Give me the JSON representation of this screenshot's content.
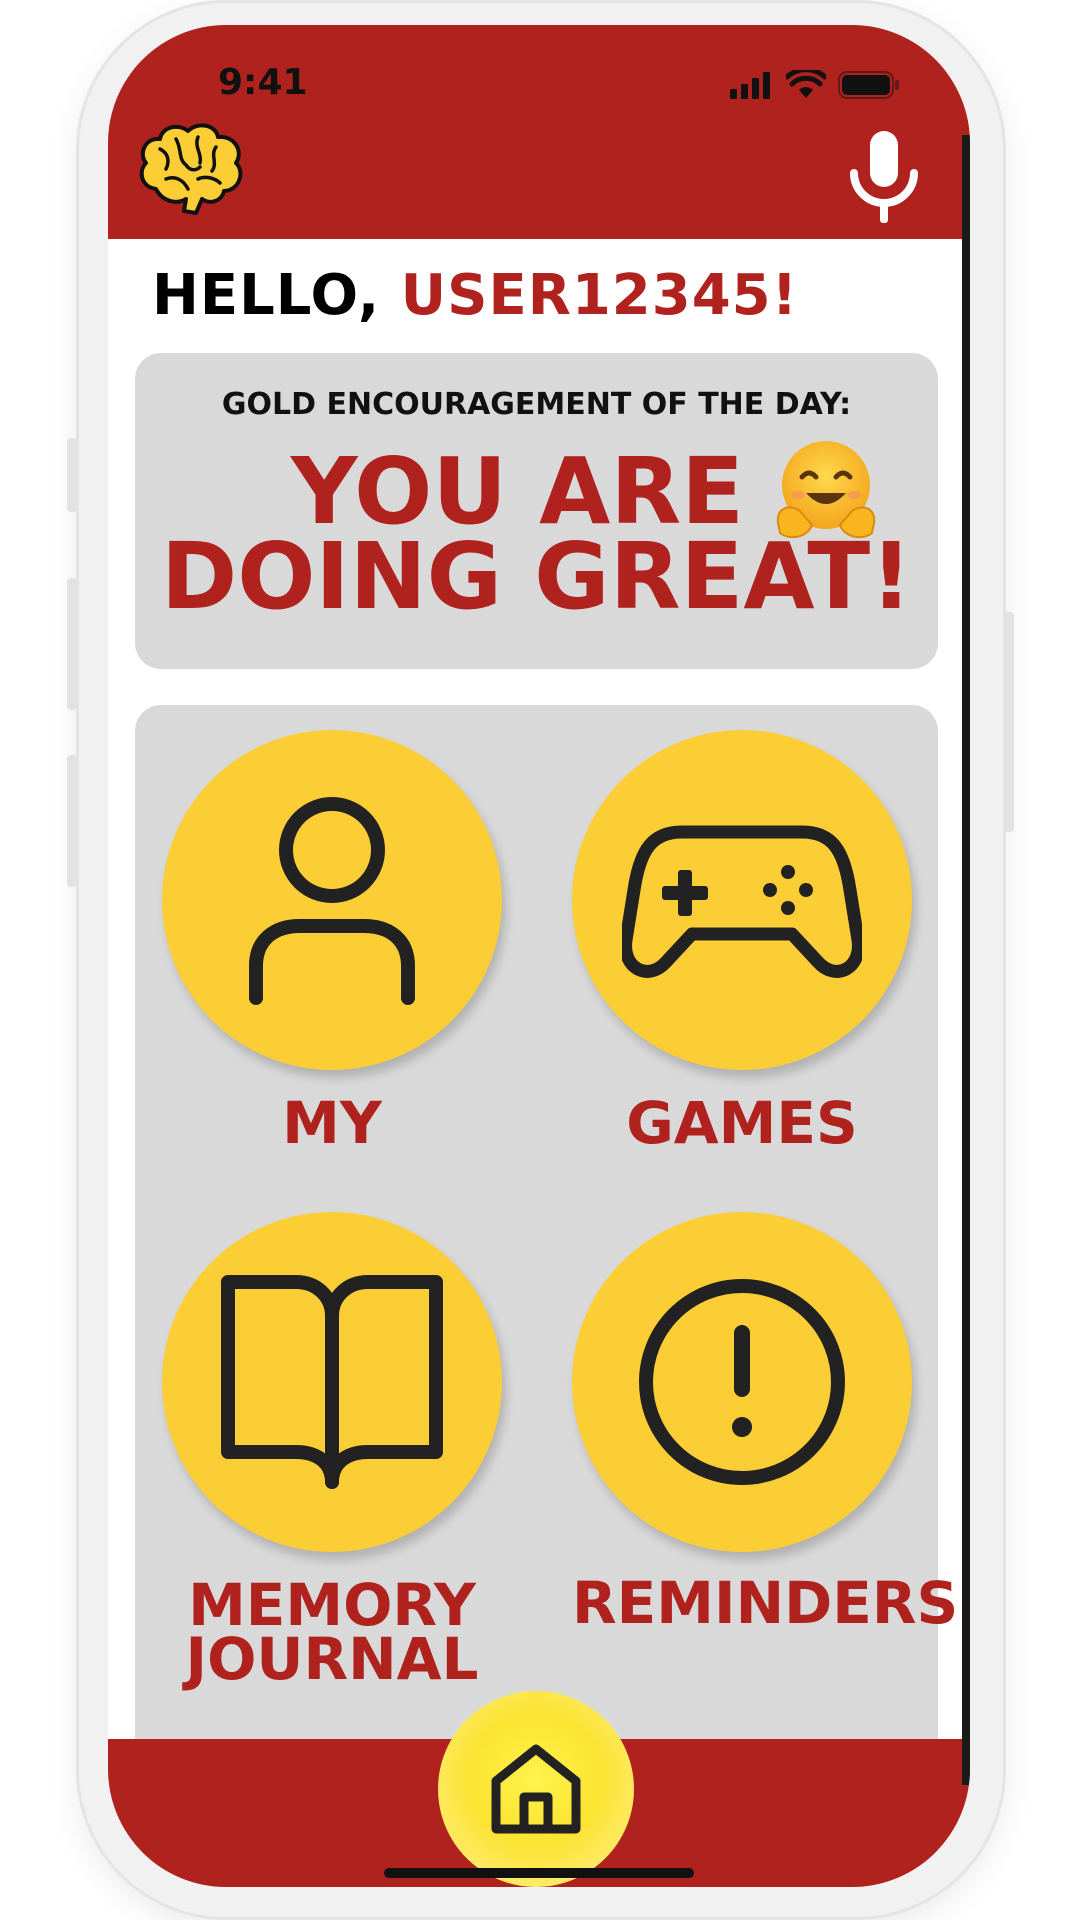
{
  "status_bar": {
    "time": "9:41"
  },
  "greeting": {
    "hello": "HELLO, ",
    "username": "USER12345!"
  },
  "encouragement": {
    "label": "GOLD ENCOURAGEMENT OF THE DAY:",
    "line1": "YOU ARE",
    "line2": "DOING GREAT!"
  },
  "menu": {
    "items": [
      {
        "label": "MY",
        "icon": "person-icon"
      },
      {
        "label": "GAMES",
        "icon": "gamepad-icon"
      },
      {
        "label": "MEMORY\nJOURNAL",
        "line1": "MEMORY",
        "line2": "JOURNAL",
        "icon": "open-book-icon"
      },
      {
        "label": "REMINDERS",
        "icon": "alert-circle-icon"
      }
    ]
  },
  "colors": {
    "brand_red": "#b0221e",
    "accent_yellow": "#fcce35",
    "card_gray": "#d9d9d9"
  }
}
